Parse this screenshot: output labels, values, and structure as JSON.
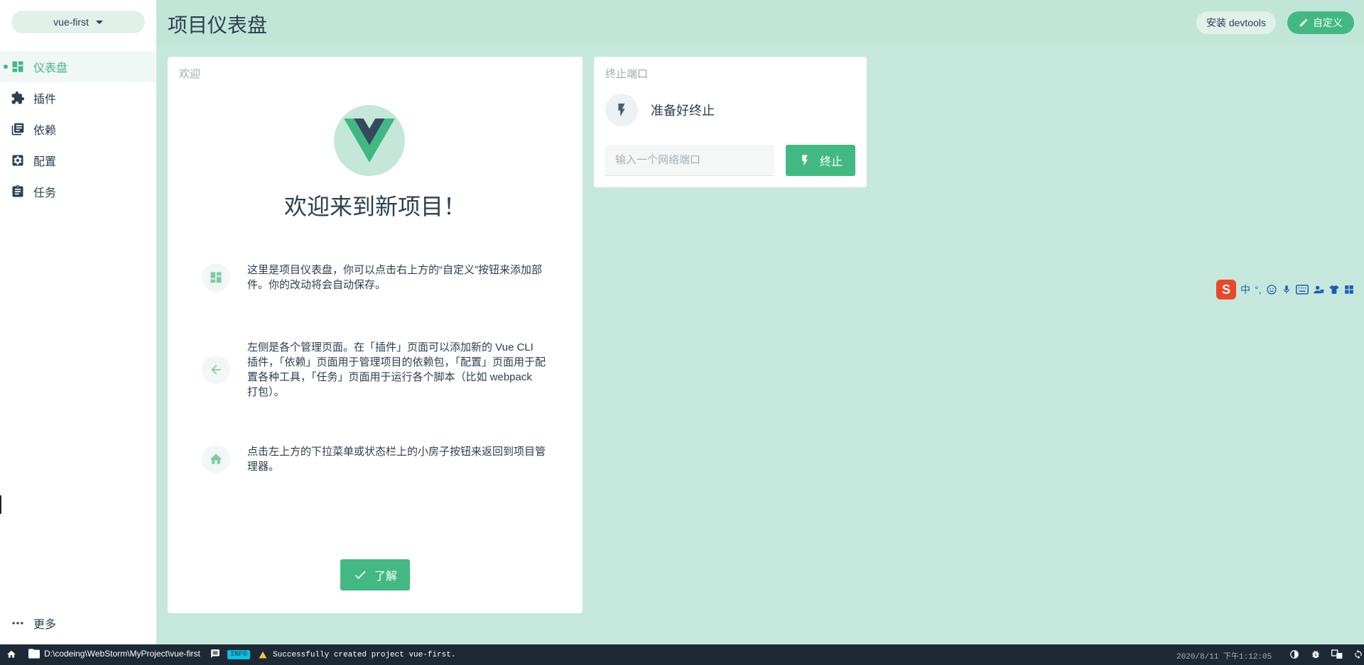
{
  "sidebar": {
    "project_name": "vue-first",
    "items": [
      {
        "label": "仪表盘",
        "icon": "dashboard-icon",
        "active": true
      },
      {
        "label": "插件",
        "icon": "puzzle-icon"
      },
      {
        "label": "依赖",
        "icon": "library-icon"
      },
      {
        "label": "配置",
        "icon": "settings-icon"
      },
      {
        "label": "任务",
        "icon": "clipboard-icon"
      }
    ],
    "more_label": "更多"
  },
  "header": {
    "title": "项目仪表盘",
    "devtools_label": "安装 devtools",
    "customize_label": "自定义"
  },
  "welcome": {
    "title": "欢迎",
    "heading": "欢迎来到新项目！",
    "tips": [
      {
        "icon": "dashboard-icon",
        "text": "这里是项目仪表盘，你可以点击右上方的“自定义”按钮来添加部件。你的改动将会自动保存。"
      },
      {
        "icon": "arrow-left-icon",
        "text": "左侧是各个管理页面。在「插件」页面可以添加新的 Vue CLI 插件，「依赖」页面用于管理项目的依赖包，「配置」页面用于配置各种工具，「任务」页面用于运行各个脚本（比如 webpack 打包）。"
      },
      {
        "icon": "home-icon",
        "text": "点击左上方的下拉菜单或状态栏上的小房子按钮来返回到项目管理器。"
      }
    ],
    "ok_label": "了解"
  },
  "kill_port": {
    "title": "终止端口",
    "status": "准备好终止",
    "input_placeholder": "输入一个网络端口",
    "button_label": "终止"
  },
  "ime": {
    "logo": "S",
    "lang": "中",
    "punct": "°,"
  },
  "statusbar": {
    "path": "D:\\codeing\\WebStorm\\MyProject\\vue-first",
    "log_level": "INFO",
    "message": "Successfully created project vue-first.",
    "time": "2020/8/11 下午1:12:05"
  },
  "colors": {
    "accent": "#42b983",
    "background": "#c6e8dc",
    "statusbar": "#1d2935",
    "text": "#2c3e50"
  }
}
